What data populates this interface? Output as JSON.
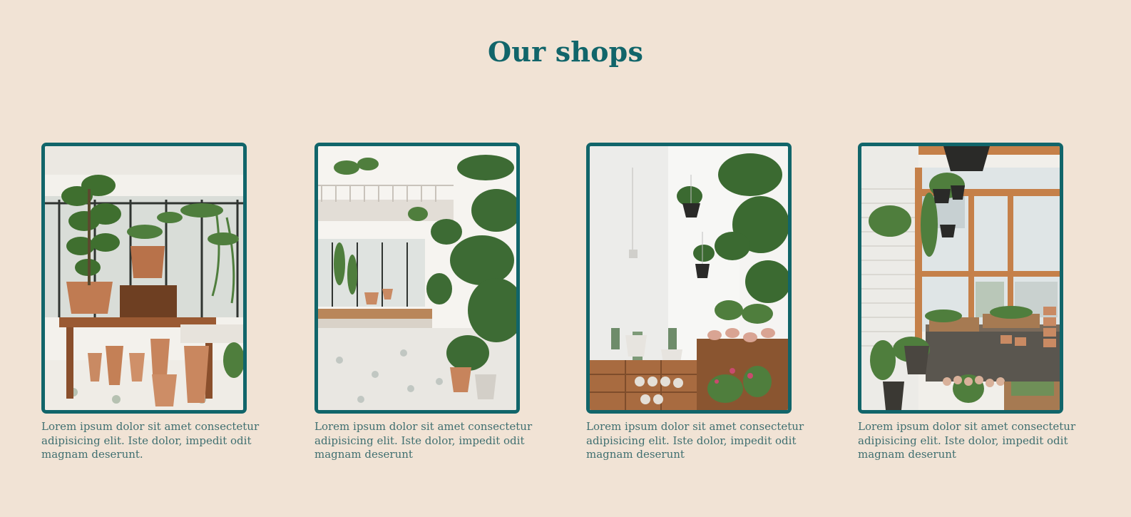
{
  "page": {
    "title": "Our shops"
  },
  "colors": {
    "background": "#f1e3d5",
    "accent": "#11656a",
    "caption_text": "#3f6f70"
  },
  "shops": [
    {
      "image_alt": "plant-shop-photo",
      "caption": "Lorem ipsum dolor sit amet consectetur adipisicing elit. Iste dolor, impedit odit magnam deserunt."
    },
    {
      "image_alt": "plant-shop-photo",
      "caption": "Lorem ipsum dolor sit amet consectetur adipisicing elit. Iste dolor, impedit odit magnam deserunt"
    },
    {
      "image_alt": "plant-shop-photo",
      "caption": "Lorem ipsum dolor sit amet consectetur adipisicing elit. Iste dolor, impedit odit magnam deserunt"
    },
    {
      "image_alt": "plant-shop-photo",
      "caption": "Lorem ipsum dolor sit amet consectetur adipisicing elit. Iste dolor, impedit odit magnam deserunt"
    }
  ]
}
